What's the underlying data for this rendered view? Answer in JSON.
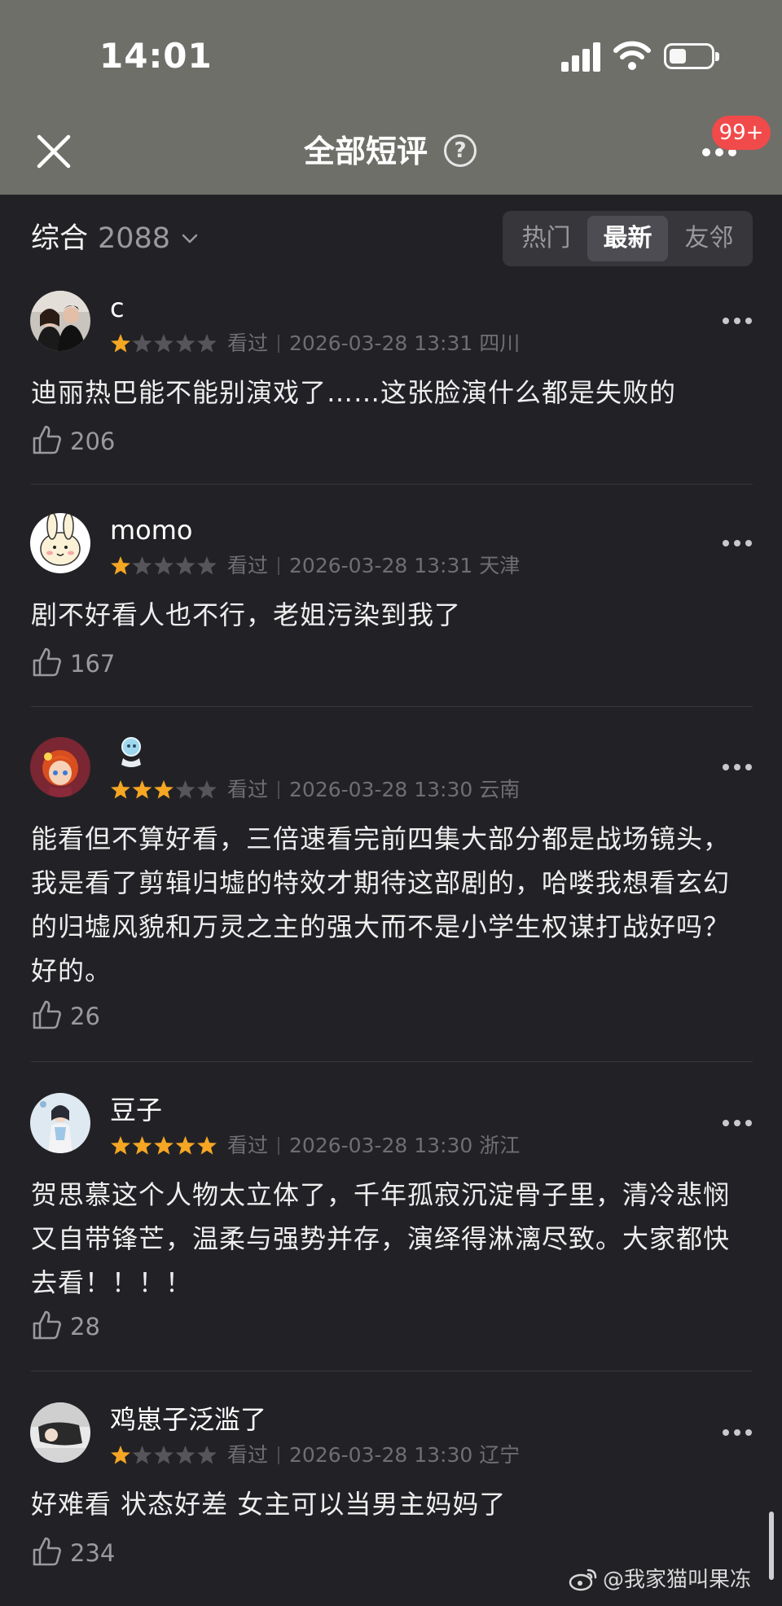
{
  "status_bar": {
    "time": "14:01"
  },
  "nav": {
    "title": "全部短评",
    "notification_badge": "99+"
  },
  "filter": {
    "sort_label": "综合",
    "total_count": "2088",
    "tabs": [
      "热门",
      "最新",
      "友邻"
    ],
    "active_tab": "最新"
  },
  "colors": {
    "star_filled": "#f5a623",
    "star_empty": "#55555a",
    "badge": "#f14a4a",
    "header_bg": "#6f6f6a",
    "page_bg": "#222226"
  },
  "reviews": [
    {
      "user": "c",
      "rating": 1,
      "watched": "看过",
      "datetime": "2026-03-28 13:31",
      "region": "四川",
      "text": "迪丽热巴能不能别演戏了……这张脸演什么都是失败的",
      "likes": "206"
    },
    {
      "user": "momo",
      "rating": 1,
      "watched": "看过",
      "datetime": "2026-03-28 13:31",
      "region": "天津",
      "text": "剧不好看人也不行，老姐污染到我了",
      "likes": "167"
    },
    {
      "user": "",
      "rating": 3,
      "watched": "看过",
      "datetime": "2026-03-28 13:30",
      "region": "云南",
      "text": "能看但不算好看，三倍速看完前四集大部分都是战场镜头，我是看了剪辑归墟的特效才期待这部剧的，哈喽我想看玄幻的归墟风貌和万灵之主的强大而不是小学生权谋打战好吗？好的。",
      "likes": "26"
    },
    {
      "user": "豆子",
      "rating": 5,
      "watched": "看过",
      "datetime": "2026-03-28 13:30",
      "region": "浙江",
      "text": "贺思慕这个人物太立体了，千年孤寂沉淀骨子里，清冷悲悯又自带锋芒，温柔与强势并存，演绎得淋漓尽致。大家都快去看！！！！",
      "likes": "28"
    },
    {
      "user": "鸡崽子泛滥了",
      "rating": 1,
      "watched": "看过",
      "datetime": "2026-03-28 13:30",
      "region": "辽宁",
      "text": "好难看 状态好差 女主可以当男主妈妈了",
      "likes": "234"
    }
  ],
  "watermark": "@我家猫叫果冻"
}
